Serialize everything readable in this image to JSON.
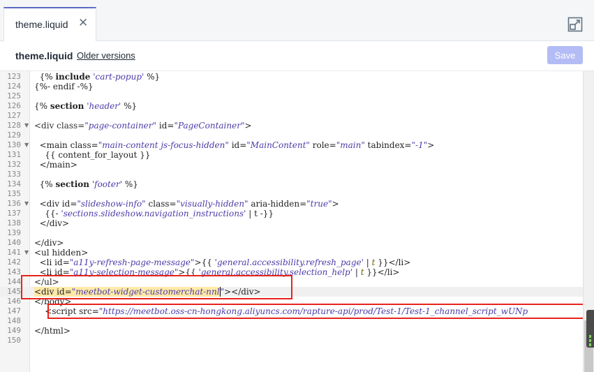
{
  "tab": {
    "title": "theme.liquid",
    "close_icon": "close-icon"
  },
  "header": {
    "file_name": "theme.liquid",
    "older_versions_label": "Older versions",
    "save_label": "Save"
  },
  "editor": {
    "lines": [
      {
        "n": "123",
        "fold": false,
        "html": "  {% <span class='kw'>include</span> <span class='str'>'cart-popup'</span> %}"
      },
      {
        "n": "124",
        "fold": false,
        "html": "{%- endif -%}"
      },
      {
        "n": "125",
        "fold": false,
        "html": ""
      },
      {
        "n": "126",
        "fold": false,
        "html": "{% <span class='kw'>section</span> <span class='str'>'header'</span> %}"
      },
      {
        "n": "127",
        "fold": false,
        "html": ""
      },
      {
        "n": "128",
        "fold": true,
        "html": "<span class='attr'>&lt;div class=</span><span class='str'>\"page-container\"</span> id=<span class='str'>\"PageContainer\"</span>&gt;"
      },
      {
        "n": "129",
        "fold": false,
        "html": ""
      },
      {
        "n": "130",
        "fold": true,
        "html": "  &lt;main class=<span class='str'>\"main-content js-focus-hidden\"</span> id=<span class='str'>\"MainContent\"</span> role=<span class='str'>\"main\"</span> tabindex=<span class='str'>\"-1\"</span>&gt;"
      },
      {
        "n": "131",
        "fold": false,
        "html": "    {{ content_for_layout }}"
      },
      {
        "n": "132",
        "fold": false,
        "html": "  &lt;/main&gt;"
      },
      {
        "n": "133",
        "fold": false,
        "html": ""
      },
      {
        "n": "134",
        "fold": false,
        "html": "  {% <span class='kw'>section</span> <span class='str'>'footer'</span> %}"
      },
      {
        "n": "135",
        "fold": false,
        "html": ""
      },
      {
        "n": "136",
        "fold": true,
        "html": "  &lt;div id=<span class='str'>\"slideshow-info\"</span> class=<span class='str'>\"visually-hidden\"</span> aria-hidden=<span class='str'>\"true\"</span>&gt;"
      },
      {
        "n": "137",
        "fold": false,
        "html": "    {{- <span class='str'>'sections.slideshow.navigation_instructions'</span> | t -}}"
      },
      {
        "n": "138",
        "fold": false,
        "html": "  &lt;/div&gt;"
      },
      {
        "n": "139",
        "fold": false,
        "html": ""
      },
      {
        "n": "140",
        "fold": false,
        "html": "&lt;/div&gt;"
      },
      {
        "n": "141",
        "fold": true,
        "html": "&lt;ul hidden&gt;"
      },
      {
        "n": "142",
        "fold": false,
        "html": "  &lt;li id=<span class='str'>\"a11y-refresh-page-message\"</span>&gt;{{ <span class='str'>'general.accessibility.refresh_page'</span> | <span class='t'>t</span> }}&lt;/li&gt;"
      },
      {
        "n": "143",
        "fold": false,
        "html": "  &lt;li id=<span class='str'>\"a11y-selection-message\"</span>&gt;{{ <span class='str'>'general.accessibility.selection_help'</span> | <span class='t'>t</span> }}&lt;/li&gt;"
      },
      {
        "n": "144",
        "fold": false,
        "html": "&lt;/ul&gt;"
      },
      {
        "n": "145",
        "fold": false,
        "active": true,
        "html": "<span class='sel'>&lt;div id=<span class='str'>\"meetbot-widget-customerchat-nnl</span></span><span class='caret'></span><span class='str'>\"</span>&gt;&lt;/div&gt;"
      },
      {
        "n": "146",
        "fold": false,
        "html": "&lt;/body&gt;"
      },
      {
        "n": "147",
        "fold": false,
        "html": "    &lt;script src=<span class='str'>\"https://meetbot.oss-cn-hongkong.aliyuncs.com/rapture-api/prod/Test-1/Test-1_channel_script_wUNp</span>"
      },
      {
        "n": "148",
        "fold": false,
        "html": ""
      },
      {
        "n": "149",
        "fold": false,
        "html": "&lt;/html&gt;"
      },
      {
        "n": "150",
        "fold": false,
        "html": ""
      }
    ]
  }
}
